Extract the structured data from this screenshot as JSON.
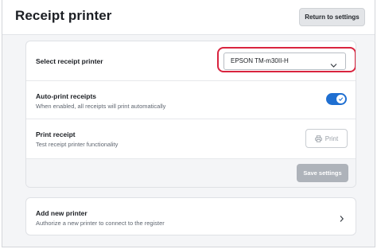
{
  "header": {
    "title": "Receipt printer",
    "return_label": "Return to settings"
  },
  "settings": {
    "select_printer": {
      "label": "Select receipt printer",
      "value": "EPSON TM-m30II-H"
    },
    "auto_print": {
      "label": "Auto-print receipts",
      "description": "When enabled, all receipts will print automatically",
      "enabled": true
    },
    "print_receipt": {
      "label": "Print receipt",
      "description": "Test receipt printer functionality",
      "button_label": "Print"
    },
    "save_label": "Save settings"
  },
  "add_printer": {
    "label": "Add new printer",
    "description": "Authorize a new printer to connect to the register"
  },
  "colors": {
    "accent": "#1f6fd1",
    "highlight": "#d9243f",
    "save_disabled": "#aeb3ba"
  }
}
